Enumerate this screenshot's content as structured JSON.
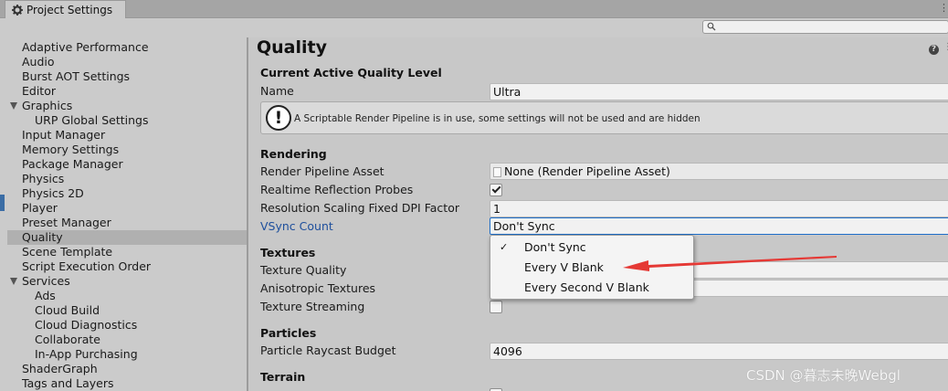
{
  "window": {
    "tab_title": "Project Settings"
  },
  "search": {
    "placeholder": ""
  },
  "sidebar": {
    "items": [
      {
        "label": "Adaptive Performance"
      },
      {
        "label": "Audio"
      },
      {
        "label": "Burst AOT Settings"
      },
      {
        "label": "Editor"
      },
      {
        "label": "Graphics",
        "expanded": true
      },
      {
        "label": "URP Global Settings",
        "child": true
      },
      {
        "label": "Input Manager"
      },
      {
        "label": "Memory Settings"
      },
      {
        "label": "Package Manager"
      },
      {
        "label": "Physics"
      },
      {
        "label": "Physics 2D"
      },
      {
        "label": "Player"
      },
      {
        "label": "Preset Manager"
      },
      {
        "label": "Quality",
        "selected": true
      },
      {
        "label": "Scene Template"
      },
      {
        "label": "Script Execution Order"
      },
      {
        "label": "Services",
        "expanded": true
      },
      {
        "label": "Ads",
        "child": true
      },
      {
        "label": "Cloud Build",
        "child": true
      },
      {
        "label": "Cloud Diagnostics",
        "child": true
      },
      {
        "label": "Collaborate",
        "child": true
      },
      {
        "label": "In-App Purchasing",
        "child": true
      },
      {
        "label": "ShaderGraph"
      },
      {
        "label": "Tags and Layers"
      }
    ]
  },
  "main": {
    "title": "Quality",
    "current_level": {
      "header": "Current Active Quality Level",
      "name_label": "Name",
      "name_value": "Ultra",
      "info_message": "A Scriptable Render Pipeline is in use, some settings will not be used and are hidden"
    },
    "rendering": {
      "header": "Rendering",
      "pipeline_label": "Render Pipeline Asset",
      "pipeline_value": "None (Render Pipeline Asset)",
      "reflection_label": "Realtime Reflection Probes",
      "reflection_checked": true,
      "dpi_label": "Resolution Scaling Fixed DPI Factor",
      "dpi_value": "1",
      "vsync_label": "VSync Count",
      "vsync_value": "Don't Sync"
    },
    "textures": {
      "header": "Textures",
      "quality_label": "Texture Quality",
      "aniso_label": "Anisotropic Textures",
      "streaming_label": "Texture Streaming",
      "streaming_checked": false
    },
    "particles": {
      "header": "Particles",
      "raycast_label": "Particle Raycast Budget",
      "raycast_value": "4096"
    },
    "terrain": {
      "header": "Terrain"
    }
  },
  "vsync_dropdown": {
    "options": [
      {
        "label": "Don't Sync",
        "checked": true,
        "check_glyph": "✓"
      },
      {
        "label": "Every V Blank",
        "checked": false
      },
      {
        "label": "Every Second V Blank",
        "checked": false
      }
    ]
  },
  "watermark": "CSDN @暮志未晚Webgl",
  "colors": {
    "arrow": "#e53935",
    "link": "#1e4f9c",
    "selected_row": "#b0b0b0"
  }
}
